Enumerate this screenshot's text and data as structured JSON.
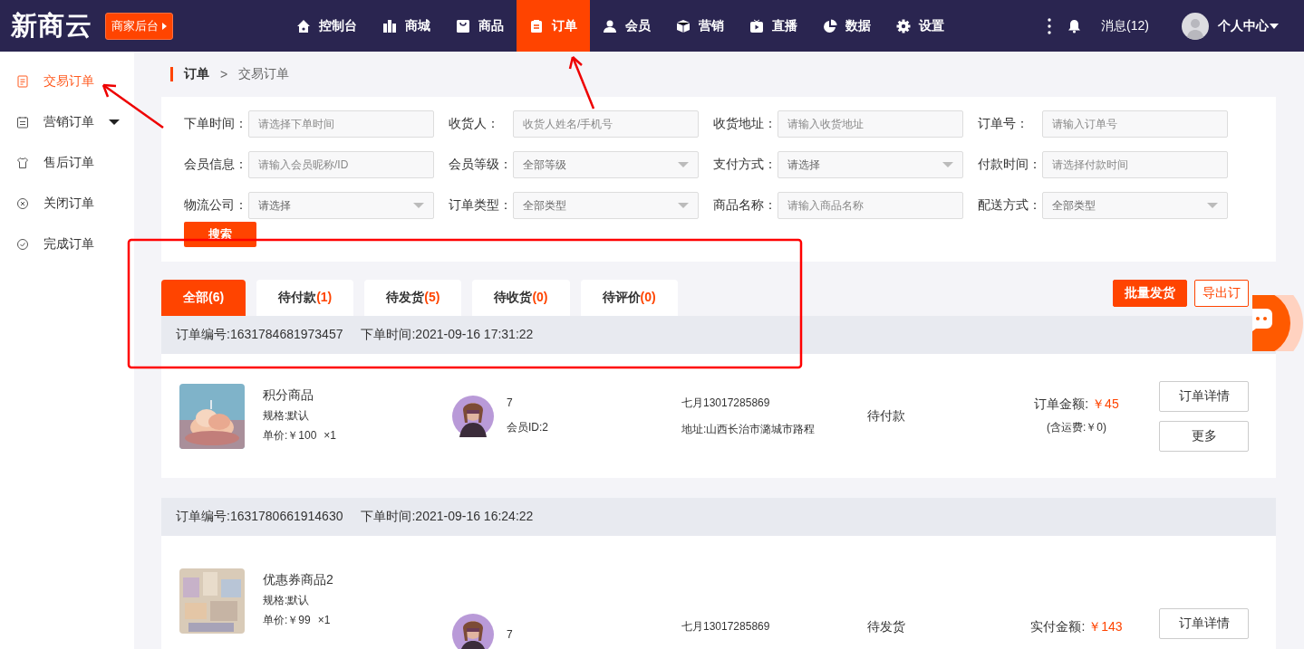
{
  "brand": {
    "logo": "新商云",
    "badge": "商家后台"
  },
  "nav": [
    {
      "label": "控制台",
      "selected": false
    },
    {
      "label": "商城",
      "selected": false
    },
    {
      "label": "商品",
      "selected": false
    },
    {
      "label": "订单",
      "selected": true
    },
    {
      "label": "会员",
      "selected": false
    },
    {
      "label": "营销",
      "selected": false
    },
    {
      "label": "直播",
      "selected": false
    },
    {
      "label": "数据",
      "selected": false
    },
    {
      "label": "设置",
      "selected": false
    }
  ],
  "header": {
    "messages": "消息(12)",
    "user": "个人中心"
  },
  "sidebar": [
    {
      "label": "交易订单",
      "selected": true,
      "kind": "link"
    },
    {
      "label": "营销订单",
      "selected": false,
      "kind": "group"
    },
    {
      "label": "售后订单",
      "selected": false,
      "kind": "link"
    },
    {
      "label": "关闭订单",
      "selected": false,
      "kind": "link"
    },
    {
      "label": "完成订单",
      "selected": false,
      "kind": "link"
    }
  ],
  "breadcrumb": {
    "items": [
      "订单",
      "交易订单"
    ],
    "separator": ">"
  },
  "filters": [
    {
      "label": "下单时间：",
      "placeholder": "请选择下单时间",
      "kind": "input"
    },
    {
      "label": "收货人：",
      "placeholder": "收货人姓名/手机号",
      "kind": "input"
    },
    {
      "label": "收货地址：",
      "placeholder": "请输入收货地址",
      "kind": "input"
    },
    {
      "label": "订单号：",
      "placeholder": "请输入订单号",
      "kind": "input"
    },
    {
      "label": "会员信息：",
      "placeholder": "请输入会员昵称/ID",
      "kind": "input"
    },
    {
      "label": "会员等级：",
      "value": "全部等级",
      "kind": "select"
    },
    {
      "label": "支付方式：",
      "value": "请选择",
      "kind": "select"
    },
    {
      "label": "付款时间：",
      "placeholder": "请选择付款时间",
      "kind": "input"
    },
    {
      "label": "物流公司：",
      "value": "请选择",
      "kind": "select"
    },
    {
      "label": "订单类型：",
      "value": "全部类型",
      "kind": "select"
    },
    {
      "label": "商品名称：",
      "placeholder": "请输入商品名称",
      "kind": "input"
    },
    {
      "label": "配送方式：",
      "value": "全部类型",
      "kind": "select"
    }
  ],
  "search_button": "搜索",
  "tabs": [
    {
      "label": "全部",
      "count": "(6)",
      "selected": true
    },
    {
      "label": "待付款",
      "count": "(1)",
      "selected": false
    },
    {
      "label": "待发货",
      "count": "(5)",
      "selected": false
    },
    {
      "label": "待收货",
      "count": "(0)",
      "selected": false
    },
    {
      "label": "待评价",
      "count": "(0)",
      "selected": false
    }
  ],
  "actions": [
    {
      "label": "批量发货",
      "kind": "primary"
    },
    {
      "label": "导出订",
      "kind": "outline"
    }
  ],
  "orders": [
    {
      "number": "订单编号:1631784681973457",
      "time": "下单时间:2021-09-16 17:31:22",
      "product": {
        "name": "积分商品",
        "spec": "规格:默认",
        "price": "单价:￥100",
        "qty": "×1"
      },
      "member": {
        "name": "7",
        "id": "会员ID:2"
      },
      "contact": "七月13017285869",
      "address": "地址:山西长治市潞城市路程",
      "status": "待付款",
      "amount_label": "订单金额:",
      "amount": "￥45",
      "shipping": "(含运费:￥0)",
      "buttons": [
        "订单详情",
        "更多"
      ]
    },
    {
      "number": "订单编号:1631780661914630",
      "time": "下单时间:2021-09-16 16:24:22",
      "product": {
        "name": "优惠券商品2",
        "spec": "规格:默认",
        "price": "单价:￥99",
        "qty": "×1"
      },
      "member": {
        "name": "7"
      },
      "contact": "七月13017285869",
      "status": "待发货",
      "amount_label": "实付金额:",
      "amount": "￥143",
      "buttons": [
        "订单详情"
      ]
    }
  ]
}
